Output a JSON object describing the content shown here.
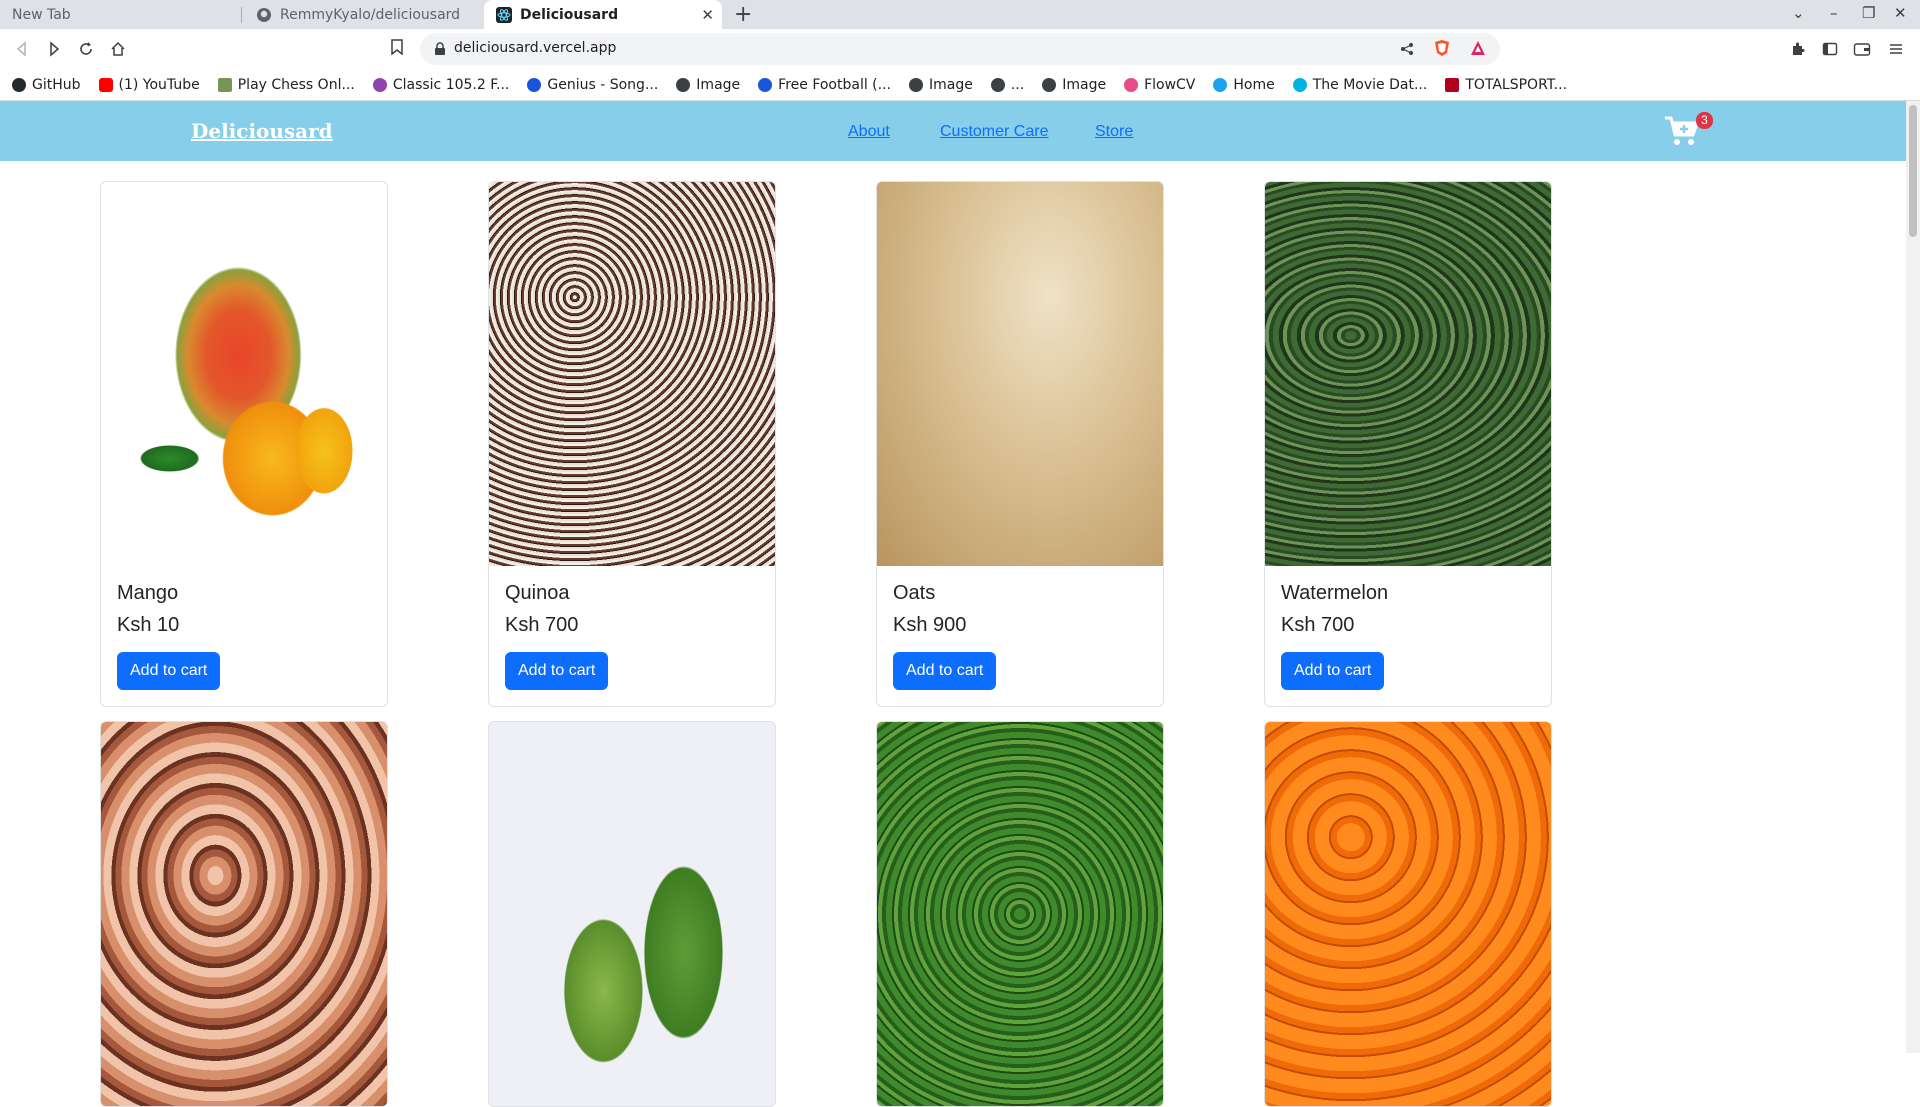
{
  "browser": {
    "tabs": [
      {
        "title": "New Tab",
        "active": false
      },
      {
        "title": "RemmyKyalo/deliciousard",
        "active": false
      },
      {
        "title": "Deliciousard",
        "active": true
      }
    ],
    "url": "deliciousard.vercel.app",
    "bookmarks": [
      {
        "label": "GitHub",
        "icon": "github-icon",
        "color": "#24292e"
      },
      {
        "label": "(1) YouTube",
        "icon": "youtube-icon",
        "color": "#ff0000"
      },
      {
        "label": "Play Chess Onl...",
        "icon": "chess-icon",
        "color": "#769656"
      },
      {
        "label": "Classic 105.2 F...",
        "icon": "radio-icon",
        "color": "#8e44ad"
      },
      {
        "label": "Genius - Song...",
        "icon": "genius-icon",
        "color": "#1a56db"
      },
      {
        "label": "Image",
        "icon": "globe-icon",
        "color": "#3c4043"
      },
      {
        "label": "Free Football (...",
        "icon": "genius-icon",
        "color": "#1a56db"
      },
      {
        "label": "Image",
        "icon": "globe-icon",
        "color": "#3c4043"
      },
      {
        "label": "...",
        "icon": "globe-icon",
        "color": "#3c4043"
      },
      {
        "label": "Image",
        "icon": "globe-icon",
        "color": "#3c4043"
      },
      {
        "label": "FlowCV",
        "icon": "flowcv-icon",
        "color": "#e84a8a"
      },
      {
        "label": "Home",
        "icon": "twitter-icon",
        "color": "#1da1f2"
      },
      {
        "label": "The Movie Dat...",
        "icon": "tmdb-icon",
        "color": "#01b4e4"
      },
      {
        "label": "TOTALSPORT...",
        "icon": "totalsport-icon",
        "color": "#b00020"
      }
    ]
  },
  "site": {
    "brand": "Deliciousard",
    "nav": [
      {
        "label": "About"
      },
      {
        "label": "Customer Care"
      },
      {
        "label": "Store"
      }
    ],
    "cart_count": "3",
    "accent": "#87ceeb",
    "button_color": "#0d6efd"
  },
  "products": [
    {
      "name": "Mango",
      "price": "Ksh 10",
      "button": "Add to cart",
      "image": "mango-image"
    },
    {
      "name": "Quinoa",
      "price": "Ksh 700",
      "button": "Add to cart",
      "image": "quinoa-image"
    },
    {
      "name": "Oats",
      "price": "Ksh 900",
      "button": "Add to cart",
      "image": "oats-image"
    },
    {
      "name": "Watermelon",
      "price": "Ksh 700",
      "button": "Add to cart",
      "image": "watermelon-image"
    },
    {
      "image": "onions-image"
    },
    {
      "image": "papaya-image"
    },
    {
      "image": "broccoli-image"
    },
    {
      "image": "oranges-image"
    }
  ]
}
